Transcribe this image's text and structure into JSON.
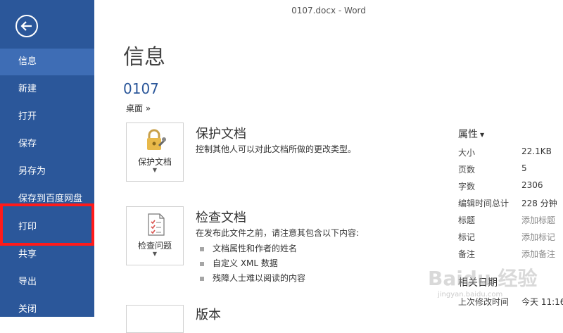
{
  "window": {
    "title": "0107.docx - Word"
  },
  "sidebar": {
    "items": [
      {
        "label": "信息"
      },
      {
        "label": "新建"
      },
      {
        "label": "打开"
      },
      {
        "label": "保存"
      },
      {
        "label": "另存为"
      },
      {
        "label": "保存到百度网盘"
      },
      {
        "label": "打印"
      },
      {
        "label": "共享"
      },
      {
        "label": "导出"
      },
      {
        "label": "关闭"
      }
    ],
    "accent": "#2b579a",
    "active_bg": "#3e6db5",
    "highlight_color": "#ff1a1a"
  },
  "main": {
    "title": "信息",
    "doc_name": "0107",
    "doc_path": "桌面 »",
    "protect": {
      "button_label": "保护文档",
      "title": "保护文档",
      "desc": "控制其他人可以对此文档所做的更改类型。",
      "icon": "lock-key-icon"
    },
    "inspect": {
      "button_label": "检查问题",
      "title": "检查文档",
      "desc": "在发布此文件之前，请注意其包含以下内容:",
      "bullets": [
        "文档属性和作者的姓名",
        "自定义 XML 数据",
        "残障人士难以阅读的内容"
      ],
      "icon": "inspect-document-icon"
    },
    "versions": {
      "title": "版本"
    }
  },
  "properties": {
    "title": "属性",
    "rows": [
      {
        "label": "大小",
        "value": "22.1KB"
      },
      {
        "label": "页数",
        "value": "5"
      },
      {
        "label": "字数",
        "value": "2306"
      },
      {
        "label": "编辑时间总计",
        "value": "228 分钟"
      },
      {
        "label": "标题",
        "value": "添加标题"
      },
      {
        "label": "标记",
        "value": "添加标记"
      },
      {
        "label": "备注",
        "value": "添加备注"
      }
    ]
  },
  "related_dates": {
    "title": "相关日期",
    "rows": [
      {
        "label": "上次修改时间",
        "value": "今天 11:16"
      }
    ]
  },
  "watermark": {
    "text": "Baidu 经验",
    "sub": "jingyan.baidu.com"
  }
}
